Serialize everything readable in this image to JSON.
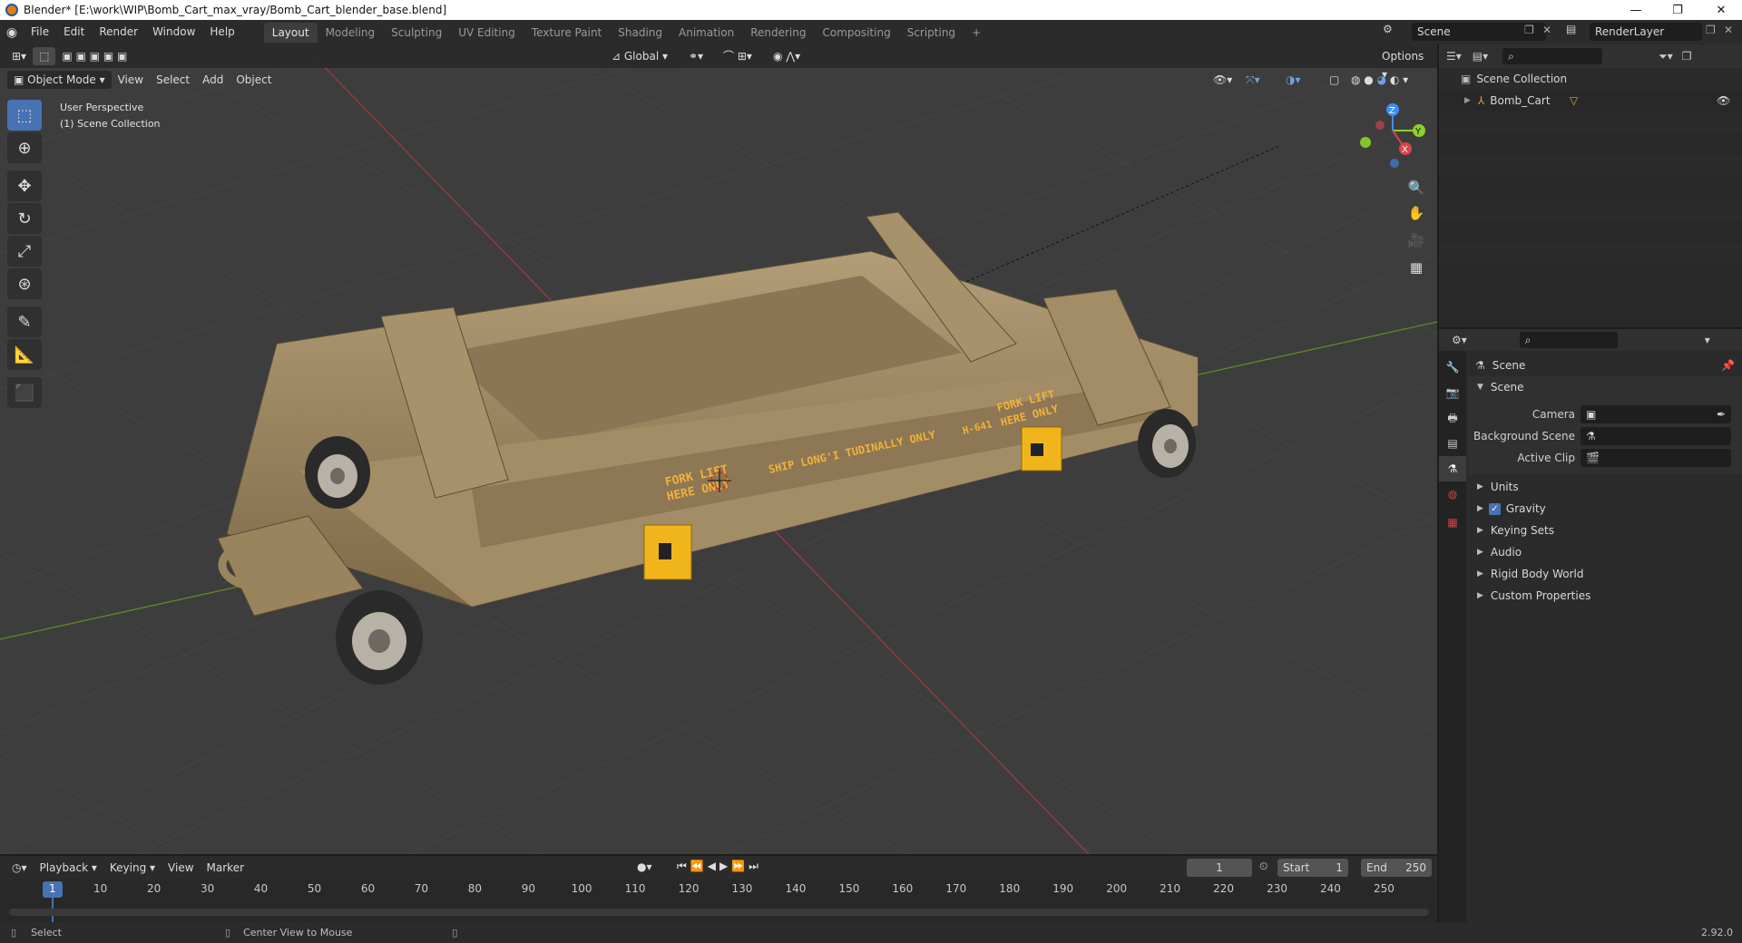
{
  "window": {
    "title": "Blender* [E:\\work\\WIP\\Bomb_Cart_max_vray/Bomb_Cart_blender_base.blend]",
    "min": "—",
    "restore": "❐",
    "close": "✕"
  },
  "menu": [
    "File",
    "Edit",
    "Render",
    "Window",
    "Help"
  ],
  "workspaces": [
    "Layout",
    "Modeling",
    "Sculpting",
    "UV Editing",
    "Texture Paint",
    "Shading",
    "Animation",
    "Rendering",
    "Compositing",
    "Scripting"
  ],
  "workspace_add": "+",
  "scene_name": "Scene",
  "render_layer": "RenderLayer",
  "viewport": {
    "transform_orientation": "Global",
    "options_label": "Options",
    "mode": "Object Mode",
    "menus": [
      "View",
      "Select",
      "Add",
      "Object"
    ],
    "overlay_text_1": "User Perspective",
    "overlay_text_2": "(1) Scene Collection",
    "gizmo": {
      "x": "X",
      "y": "Y",
      "z": "Z"
    },
    "decals": {
      "fork1a": "FORK LIFT",
      "fork1b": "HERE ONLY",
      "ship": "SHIP LONG'I TUDINALLY ONLY",
      "fork2a": "FORK LIFT",
      "fork2b": "HERE ONLY",
      "code": "H-641"
    }
  },
  "outliner": {
    "root": "Scene Collection",
    "items": [
      {
        "label": "Bomb_Cart"
      }
    ]
  },
  "properties": {
    "context": "Scene",
    "panel": "Scene",
    "camera_label": "Camera",
    "background_scene_label": "Background Scene",
    "active_clip_label": "Active Clip",
    "sections": [
      "Units",
      "Gravity",
      "Keying Sets",
      "Audio",
      "Rigid Body World",
      "Custom Properties"
    ],
    "gravity_checked": true
  },
  "timeline": {
    "menus": [
      "Playback",
      "Keying",
      "View",
      "Marker"
    ],
    "current_frame": "1",
    "start_label": "Start",
    "start": "1",
    "end_label": "End",
    "end": "250",
    "ticks": [
      "1",
      "10",
      "20",
      "30",
      "40",
      "50",
      "60",
      "70",
      "80",
      "90",
      "100",
      "110",
      "120",
      "130",
      "140",
      "150",
      "160",
      "170",
      "180",
      "190",
      "200",
      "210",
      "220",
      "230",
      "240",
      "250"
    ]
  },
  "status": {
    "select": "Select",
    "center": "Center View to Mouse",
    "version": "2.92.0"
  },
  "colors": {
    "accent": "#4772b3",
    "x_axis": "#d94451",
    "y_axis": "#8bd12a",
    "z_axis": "#3c8ef5",
    "cart": "#9c8661",
    "yellow": "#f1b51c"
  }
}
